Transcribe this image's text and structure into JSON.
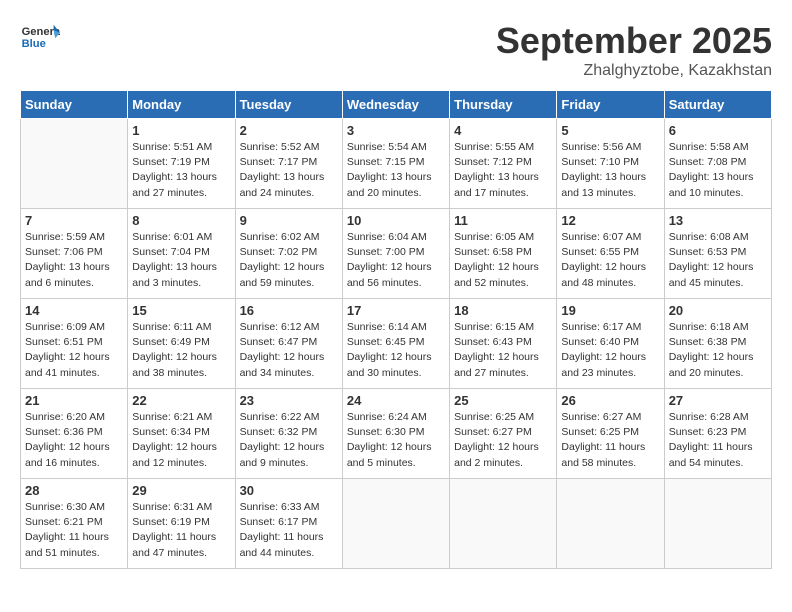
{
  "header": {
    "logo_general": "General",
    "logo_blue": "Blue",
    "month": "September 2025",
    "location": "Zhalghyztobe, Kazakhstan"
  },
  "weekdays": [
    "Sunday",
    "Monday",
    "Tuesday",
    "Wednesday",
    "Thursday",
    "Friday",
    "Saturday"
  ],
  "weeks": [
    [
      {
        "day": "",
        "info": ""
      },
      {
        "day": "1",
        "info": "Sunrise: 5:51 AM\nSunset: 7:19 PM\nDaylight: 13 hours\nand 27 minutes."
      },
      {
        "day": "2",
        "info": "Sunrise: 5:52 AM\nSunset: 7:17 PM\nDaylight: 13 hours\nand 24 minutes."
      },
      {
        "day": "3",
        "info": "Sunrise: 5:54 AM\nSunset: 7:15 PM\nDaylight: 13 hours\nand 20 minutes."
      },
      {
        "day": "4",
        "info": "Sunrise: 5:55 AM\nSunset: 7:12 PM\nDaylight: 13 hours\nand 17 minutes."
      },
      {
        "day": "5",
        "info": "Sunrise: 5:56 AM\nSunset: 7:10 PM\nDaylight: 13 hours\nand 13 minutes."
      },
      {
        "day": "6",
        "info": "Sunrise: 5:58 AM\nSunset: 7:08 PM\nDaylight: 13 hours\nand 10 minutes."
      }
    ],
    [
      {
        "day": "7",
        "info": "Sunrise: 5:59 AM\nSunset: 7:06 PM\nDaylight: 13 hours\nand 6 minutes."
      },
      {
        "day": "8",
        "info": "Sunrise: 6:01 AM\nSunset: 7:04 PM\nDaylight: 13 hours\nand 3 minutes."
      },
      {
        "day": "9",
        "info": "Sunrise: 6:02 AM\nSunset: 7:02 PM\nDaylight: 12 hours\nand 59 minutes."
      },
      {
        "day": "10",
        "info": "Sunrise: 6:04 AM\nSunset: 7:00 PM\nDaylight: 12 hours\nand 56 minutes."
      },
      {
        "day": "11",
        "info": "Sunrise: 6:05 AM\nSunset: 6:58 PM\nDaylight: 12 hours\nand 52 minutes."
      },
      {
        "day": "12",
        "info": "Sunrise: 6:07 AM\nSunset: 6:55 PM\nDaylight: 12 hours\nand 48 minutes."
      },
      {
        "day": "13",
        "info": "Sunrise: 6:08 AM\nSunset: 6:53 PM\nDaylight: 12 hours\nand 45 minutes."
      }
    ],
    [
      {
        "day": "14",
        "info": "Sunrise: 6:09 AM\nSunset: 6:51 PM\nDaylight: 12 hours\nand 41 minutes."
      },
      {
        "day": "15",
        "info": "Sunrise: 6:11 AM\nSunset: 6:49 PM\nDaylight: 12 hours\nand 38 minutes."
      },
      {
        "day": "16",
        "info": "Sunrise: 6:12 AM\nSunset: 6:47 PM\nDaylight: 12 hours\nand 34 minutes."
      },
      {
        "day": "17",
        "info": "Sunrise: 6:14 AM\nSunset: 6:45 PM\nDaylight: 12 hours\nand 30 minutes."
      },
      {
        "day": "18",
        "info": "Sunrise: 6:15 AM\nSunset: 6:43 PM\nDaylight: 12 hours\nand 27 minutes."
      },
      {
        "day": "19",
        "info": "Sunrise: 6:17 AM\nSunset: 6:40 PM\nDaylight: 12 hours\nand 23 minutes."
      },
      {
        "day": "20",
        "info": "Sunrise: 6:18 AM\nSunset: 6:38 PM\nDaylight: 12 hours\nand 20 minutes."
      }
    ],
    [
      {
        "day": "21",
        "info": "Sunrise: 6:20 AM\nSunset: 6:36 PM\nDaylight: 12 hours\nand 16 minutes."
      },
      {
        "day": "22",
        "info": "Sunrise: 6:21 AM\nSunset: 6:34 PM\nDaylight: 12 hours\nand 12 minutes."
      },
      {
        "day": "23",
        "info": "Sunrise: 6:22 AM\nSunset: 6:32 PM\nDaylight: 12 hours\nand 9 minutes."
      },
      {
        "day": "24",
        "info": "Sunrise: 6:24 AM\nSunset: 6:30 PM\nDaylight: 12 hours\nand 5 minutes."
      },
      {
        "day": "25",
        "info": "Sunrise: 6:25 AM\nSunset: 6:27 PM\nDaylight: 12 hours\nand 2 minutes."
      },
      {
        "day": "26",
        "info": "Sunrise: 6:27 AM\nSunset: 6:25 PM\nDaylight: 11 hours\nand 58 minutes."
      },
      {
        "day": "27",
        "info": "Sunrise: 6:28 AM\nSunset: 6:23 PM\nDaylight: 11 hours\nand 54 minutes."
      }
    ],
    [
      {
        "day": "28",
        "info": "Sunrise: 6:30 AM\nSunset: 6:21 PM\nDaylight: 11 hours\nand 51 minutes."
      },
      {
        "day": "29",
        "info": "Sunrise: 6:31 AM\nSunset: 6:19 PM\nDaylight: 11 hours\nand 47 minutes."
      },
      {
        "day": "30",
        "info": "Sunrise: 6:33 AM\nSunset: 6:17 PM\nDaylight: 11 hours\nand 44 minutes."
      },
      {
        "day": "",
        "info": ""
      },
      {
        "day": "",
        "info": ""
      },
      {
        "day": "",
        "info": ""
      },
      {
        "day": "",
        "info": ""
      }
    ]
  ]
}
